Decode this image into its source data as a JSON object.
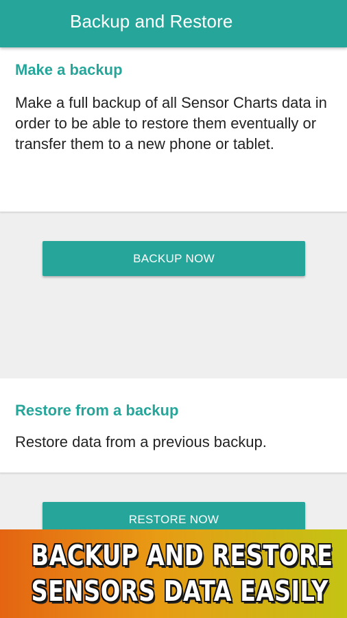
{
  "app_bar": {
    "title": "Backup and Restore"
  },
  "backup_section": {
    "heading": "Make a backup",
    "description": "Make a full backup of all Sensor Charts data in order to be able to restore them eventually or transfer them to a new phone or tablet.",
    "button_label": "BACKUP NOW"
  },
  "restore_section": {
    "heading": "Restore from a backup",
    "description": "Restore data from a previous backup.",
    "button_label": "RESTORE NOW"
  },
  "promo_banner": {
    "line1": "BACKUP AND RESTORE",
    "line2": "SENSORS DATA EASILY"
  },
  "colors": {
    "accent": "#26a69a",
    "background": "#efefef",
    "card": "#ffffff",
    "banner_start": "#e46412",
    "banner_end": "#c3c414"
  }
}
